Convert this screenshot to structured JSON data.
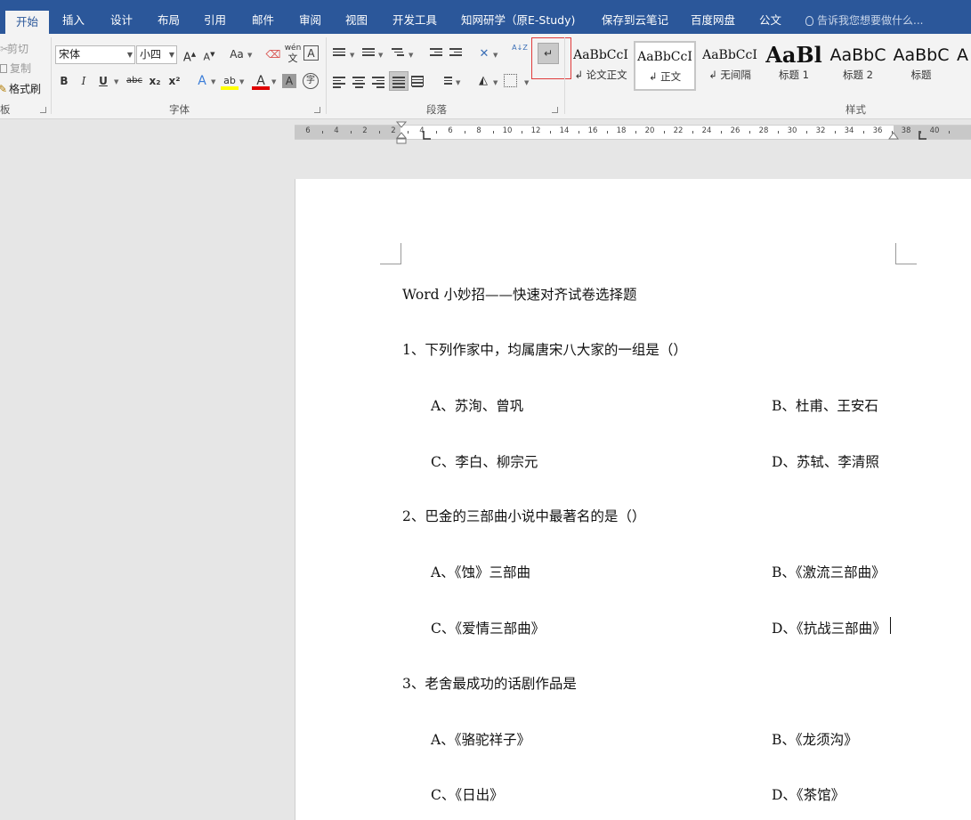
{
  "tabs": [
    {
      "label": "开始",
      "active": true
    },
    {
      "label": "插入"
    },
    {
      "label": "设计"
    },
    {
      "label": "布局"
    },
    {
      "label": "引用"
    },
    {
      "label": "邮件"
    },
    {
      "label": "审阅"
    },
    {
      "label": "视图"
    },
    {
      "label": "开发工具"
    },
    {
      "label": "知网研学（原E-Study)"
    },
    {
      "label": "保存到云笔记"
    },
    {
      "label": "百度网盘"
    },
    {
      "label": "公文"
    }
  ],
  "tell_me": "告诉我您想要做什么...",
  "clipboard": {
    "cut": "剪切",
    "copy": "复制",
    "format_painter": "格式刷",
    "label": "板"
  },
  "font": {
    "name": "宋体",
    "size": "小四",
    "grow": "A",
    "shrink": "A",
    "case": "Aa",
    "phonetic": "wén",
    "border_char": "A",
    "bold": "B",
    "italic": "I",
    "underline": "U",
    "strike": "abc",
    "subscript": "x₂",
    "superscript": "x²",
    "effects": "A",
    "highlight": "ab",
    "color": "A",
    "shading": "A",
    "enclose": "字",
    "label": "字体"
  },
  "paragraph": {
    "label": "段落",
    "sort": "A↓Z"
  },
  "styles": {
    "label": "样式",
    "items": [
      {
        "sample": "AaBbCcI",
        "name": "论文正文"
      },
      {
        "sample": "AaBbCcI",
        "name": "正文",
        "selected": true
      },
      {
        "sample": "AaBbCcI",
        "name": "无间隔"
      },
      {
        "sample": "AaBl",
        "name": "标题 1"
      },
      {
        "sample": "AaBbC",
        "name": "标题 2"
      },
      {
        "sample": "AaBbC",
        "name": "标题"
      },
      {
        "sample": "A",
        "name": ""
      }
    ]
  },
  "ruler": {
    "ticks": [
      "6",
      "4",
      "2",
      "2",
      "4",
      "6",
      "8",
      "10",
      "12",
      "14",
      "16",
      "18",
      "20",
      "22",
      "24",
      "26",
      "28",
      "30",
      "32",
      "34",
      "36",
      "38",
      "40"
    ]
  },
  "document": {
    "title": "Word 小妙招——快速对齐试卷选择题",
    "questions": [
      {
        "q": "1、下列作家中，均属唐宋八大家的一组是（）",
        "options": [
          "A、苏洵、曾巩",
          "B、杜甫、王安石",
          "C、李白、柳宗元",
          "D、苏轼、李清照"
        ]
      },
      {
        "q": "2、巴金的三部曲小说中最著名的是（）",
        "options": [
          "A、《蚀》三部曲",
          "B、《激流三部曲》",
          "C、《爱情三部曲》",
          "D、《抗战三部曲》"
        ]
      },
      {
        "q": "3、老舍最成功的话剧作品是",
        "options": [
          "A、《骆驼祥子》",
          "B、《龙须沟》",
          "C、《日出》",
          "D、《茶馆》"
        ]
      }
    ]
  }
}
